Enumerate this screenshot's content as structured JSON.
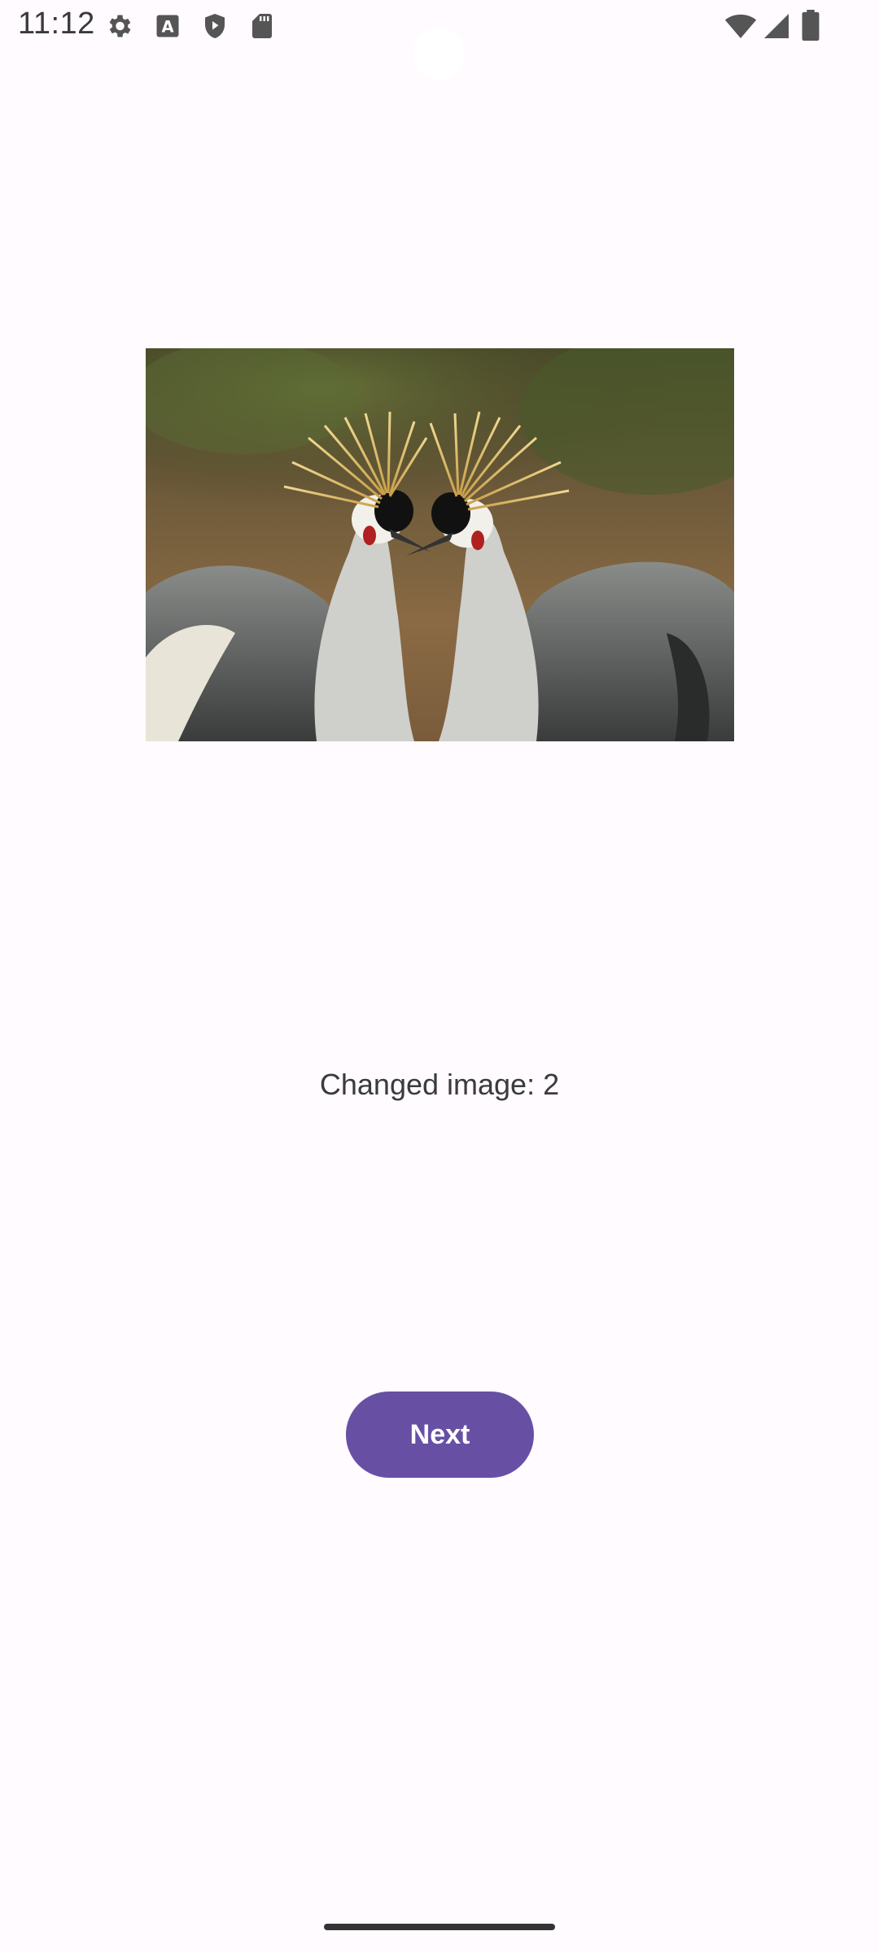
{
  "status_bar": {
    "time": "11:12",
    "left_icons": [
      "settings-icon",
      "font-a-icon",
      "shield-play-icon",
      "sd-card-icon"
    ],
    "right_icons": [
      "wifi-icon",
      "cell-signal-icon",
      "battery-icon"
    ]
  },
  "main": {
    "image_description_icon": "crowned-cranes-photo",
    "changed_label": "Changed image: 2",
    "next_label": "Next"
  },
  "colors": {
    "background": "#fffbfe",
    "accent": "#6750a4",
    "button_text": "#ffffff"
  }
}
